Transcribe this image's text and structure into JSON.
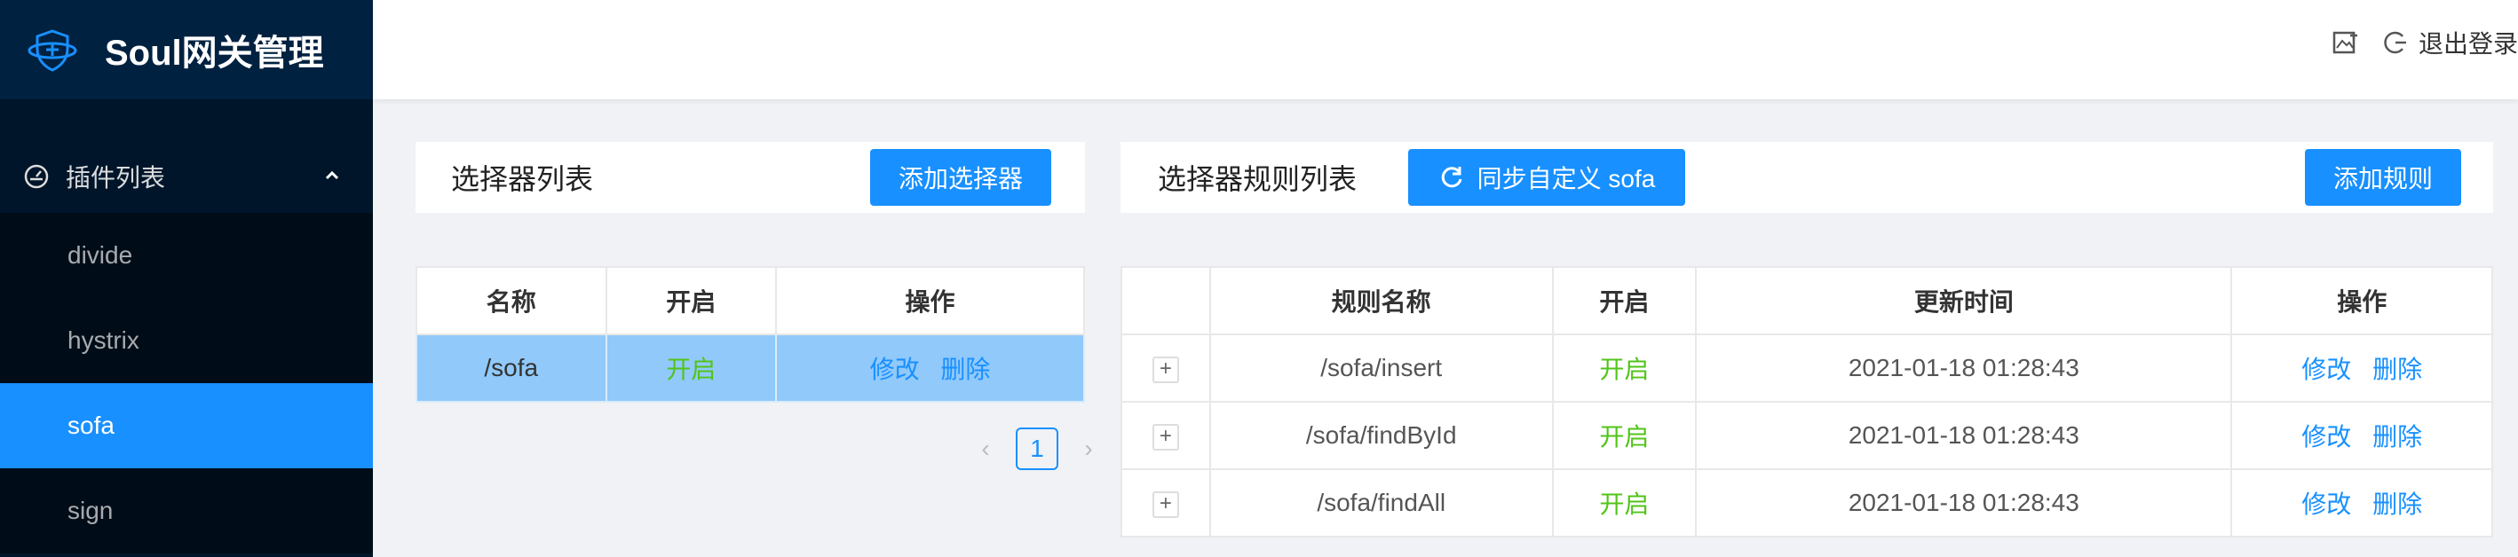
{
  "app": {
    "title": "Soul网关管理"
  },
  "header": {
    "logout_label": "退出登录"
  },
  "sidebar": {
    "group_label": "插件列表",
    "items": [
      {
        "label": "divide"
      },
      {
        "label": "hystrix"
      },
      {
        "label": "sofa",
        "active": true
      },
      {
        "label": "sign"
      }
    ]
  },
  "selector_panel": {
    "title": "选择器列表",
    "add_button": "添加选择器",
    "columns": [
      "名称",
      "开启",
      "操作"
    ],
    "rows": [
      {
        "name": "/sofa",
        "enabled": "开启",
        "edit": "修改",
        "delete": "删除"
      }
    ],
    "pagination": {
      "current_page": "1"
    }
  },
  "rule_panel": {
    "title": "选择器规则列表",
    "sync_button": "同步自定义 sofa",
    "add_button": "添加规则",
    "columns": [
      "",
      "规则名称",
      "开启",
      "更新时间",
      "操作"
    ],
    "rows": [
      {
        "expand": "+",
        "name": "/sofa/insert",
        "enabled": "开启",
        "updated": "2021-01-18 01:28:43",
        "edit": "修改",
        "delete": "删除"
      },
      {
        "expand": "+",
        "name": "/sofa/findById",
        "enabled": "开启",
        "updated": "2021-01-18 01:28:43",
        "edit": "修改",
        "delete": "删除"
      },
      {
        "expand": "+",
        "name": "/sofa/findAll",
        "enabled": "开启",
        "updated": "2021-01-18 01:28:43",
        "edit": "修改",
        "delete": "删除"
      }
    ]
  },
  "colors": {
    "primary": "#1890ff",
    "sidebar_bg": "#001529",
    "enabled_green": "#52c41a",
    "selected_row": "#91c9fb"
  }
}
